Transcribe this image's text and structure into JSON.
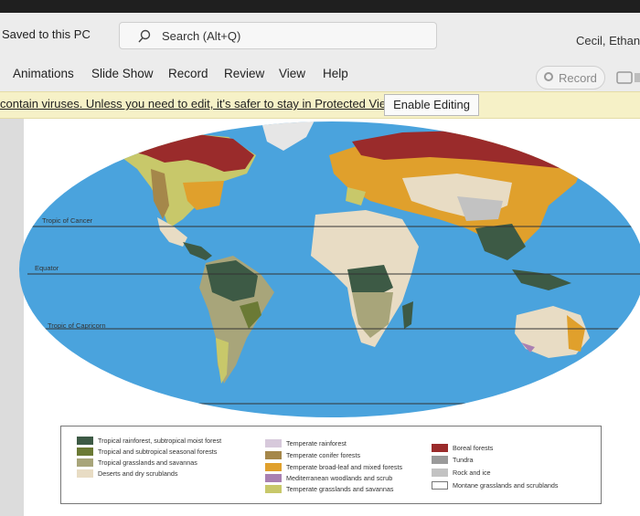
{
  "titlebar": {
    "saved_status": "Saved to this PC",
    "search_label": "Search (Alt+Q)",
    "user_name": "Cecil, Ethan C"
  },
  "ribbon": {
    "tabs": [
      "Animations",
      "Slide Show",
      "Record",
      "Review",
      "View",
      "Help"
    ],
    "record_button": "Record"
  },
  "protected_view": {
    "message": "contain viruses. Unless you need to edit, it's safer to stay in Protected View.",
    "enable_button": "Enable Editing"
  },
  "map": {
    "lines": {
      "cancer": "Tropic of Cancer",
      "equator": "Equator",
      "capricorn": "Tropic of Capricorn"
    }
  },
  "legend": {
    "items": [
      {
        "label": "Tropical rainforest, subtropical moist forest",
        "color": "#3d5a45"
      },
      {
        "label": "Tropical and subtropical seasonal forests",
        "color": "#6b7a35"
      },
      {
        "label": "Tropical grasslands and savannas",
        "color": "#a8a57a"
      },
      {
        "label": "Deserts and dry scrublands",
        "color": "#e8dcc4"
      },
      {
        "label": "Temperate rainforest",
        "color": "#d7c9db"
      },
      {
        "label": "Temperate conifer forests",
        "color": "#a5874a"
      },
      {
        "label": "Temperate broad-leaf and mixed forests",
        "color": "#e0a02c"
      },
      {
        "label": "Mediterranean woodlands and scrub",
        "color": "#a980b2"
      },
      {
        "label": "Temperate grasslands and savannas",
        "color": "#c8c86a"
      },
      {
        "label": "Boreal forests",
        "color": "#9a2b2b"
      },
      {
        "label": "Tundra",
        "color": "#9a9a9a"
      },
      {
        "label": "Rock and ice",
        "color": "#c2c2c2"
      },
      {
        "label": "Montane grasslands and scrublands",
        "color": "#ffffff"
      }
    ]
  },
  "colors": {
    "ocean": "#4aa3dd",
    "protected_bar": "#f6f1c7"
  }
}
